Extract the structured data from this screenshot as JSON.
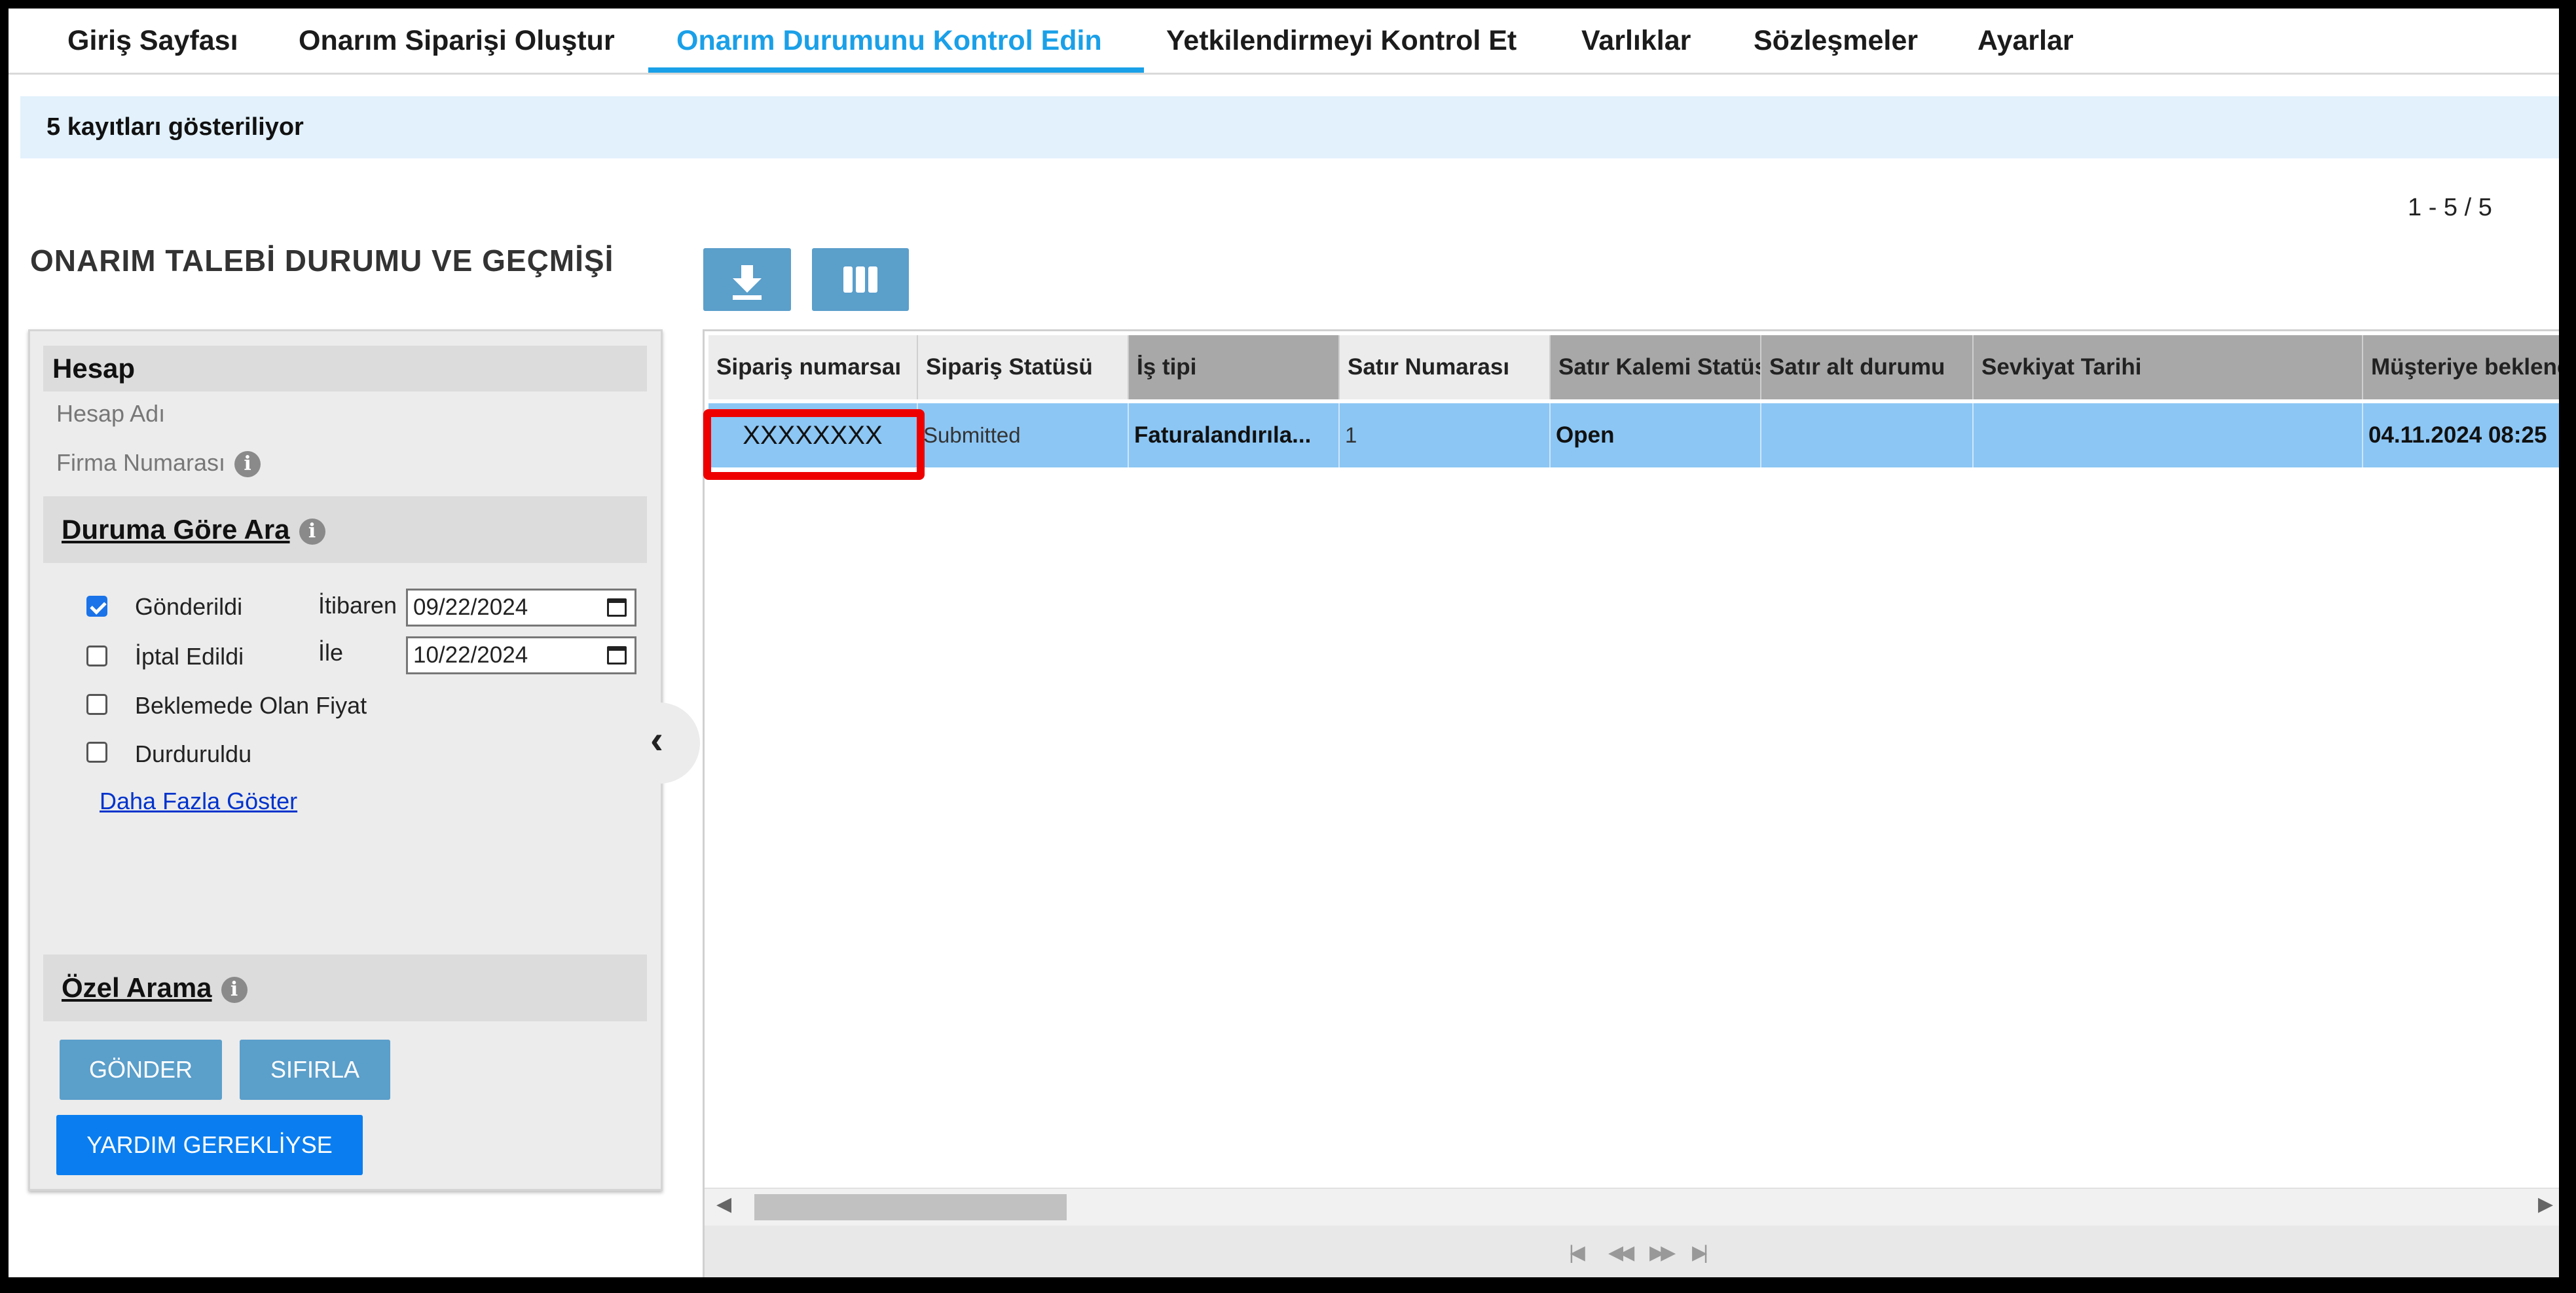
{
  "nav": {
    "tabs": [
      {
        "label": "Giriş Sayfası"
      },
      {
        "label": "Onarım Siparişi Oluştur"
      },
      {
        "label": "Onarım Durumunu Kontrol Edin",
        "active": true
      },
      {
        "label": "Yetkilendirmeyi Kontrol Et"
      },
      {
        "label": "Varlıklar"
      },
      {
        "label": "Sözleşmeler"
      },
      {
        "label": "Ayarlar"
      }
    ]
  },
  "banner": {
    "text": "5 kayıtları gösteriliyor"
  },
  "pager": {
    "range": "1 - 5 / 5"
  },
  "page_title": "ONARIM TALEBİ DURUMU VE GEÇMİŞİ",
  "panel": {
    "account": {
      "title": "Hesap",
      "name_label": "Hesap Adı",
      "firm_label": "Firma Numarası"
    },
    "status_search": {
      "title": "Duruma Göre Ara",
      "options": [
        {
          "label": "Gönderildi",
          "checked": true
        },
        {
          "label": "İptal Edildi",
          "checked": false
        },
        {
          "label": "Beklemede Olan Fiyat",
          "checked": false
        },
        {
          "label": "Durduruldu",
          "checked": false
        }
      ],
      "from_label": "İtibaren",
      "from_value": "09/22/2024",
      "to_label": "İle",
      "to_value": "10/22/2024",
      "more_link": "Daha Fazla Göster"
    },
    "custom_search": {
      "title": "Özel Arama"
    },
    "buttons": {
      "submit": "GÖNDER",
      "reset": "SIFIRLA",
      "help": "YARDIM GEREKLİYSE"
    }
  },
  "icons": {
    "info": "info-icon",
    "download": "download-icon",
    "columns": "columns-icon",
    "collapse": "chevron-left-icon"
  },
  "grid": {
    "columns": [
      "Sipariş numarsaı",
      "Sipariş Statüsü",
      "İş tipi",
      "Satır Numarası",
      "Satır Kalemi Statüsü",
      "Satır alt durumu",
      "Sevkiyat Tarihi",
      "Müşteriye beklenen"
    ],
    "rows": [
      {
        "order_no": "XXXXXXXX",
        "order_status": "Submitted",
        "job_type": "Faturalandırıla...",
        "line_no": "1",
        "line_status": "Open",
        "line_sub_status": "",
        "ship_date": "",
        "expected": "04.11.2024 08:25"
      }
    ]
  },
  "colors": {
    "accent": "#1aa0e8",
    "row_selected": "#8cc6f4",
    "highlight": "#ee0000",
    "button": "#5b9fcb",
    "button_strong": "#0a7ef0"
  }
}
